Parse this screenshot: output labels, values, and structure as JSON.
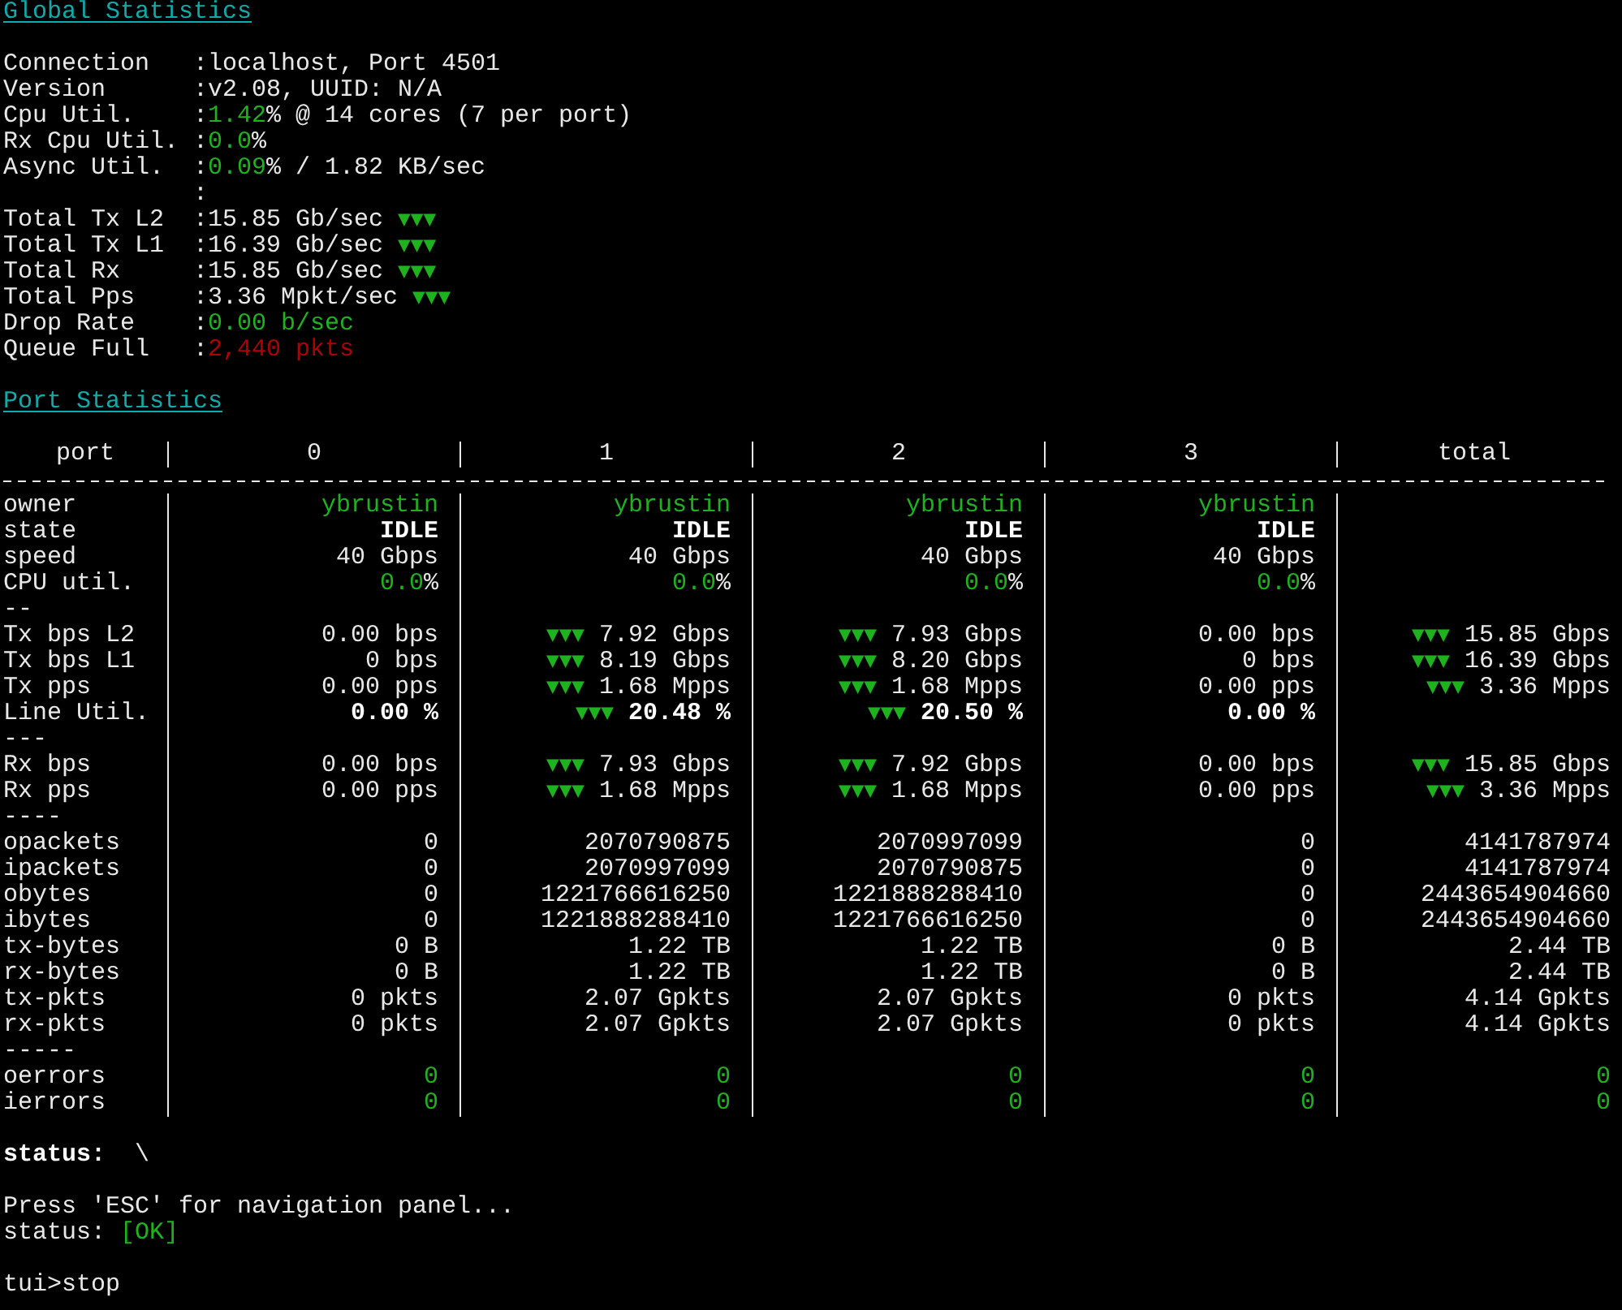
{
  "global_statistics": {
    "title": "Global Statistics",
    "lines": [
      {
        "label": "Connection",
        "sep": ":",
        "value": [
          {
            "text": "localhost, Port 4501",
            "kind": "plain"
          }
        ]
      },
      {
        "label": "Version",
        "sep": ":",
        "value": [
          {
            "text": "v2.08, UUID: N/A",
            "kind": "plain"
          }
        ]
      },
      {
        "label": "Cpu Util.",
        "sep": ":",
        "value": [
          {
            "text": "1.42",
            "kind": "green"
          },
          {
            "text": "% @ 14 cores (7 per port)",
            "kind": "plain"
          }
        ]
      },
      {
        "label": "Rx Cpu Util.",
        "sep": ":",
        "value": [
          {
            "text": "0.0",
            "kind": "green"
          },
          {
            "text": "%",
            "kind": "plain"
          }
        ]
      },
      {
        "label": "Async Util.",
        "sep": ":",
        "value": [
          {
            "text": "0.09",
            "kind": "green"
          },
          {
            "text": "% / 1.82 KB/sec",
            "kind": "plain"
          }
        ]
      },
      {
        "sep": ":"
      },
      {
        "label": "Total Tx L2",
        "sep": ":",
        "value": [
          {
            "text": "15.85 Gb/sec ",
            "kind": "plain"
          },
          {
            "text": "▼▼▼",
            "kind": "trend"
          }
        ]
      },
      {
        "label": "Total Tx L1",
        "sep": ":",
        "value": [
          {
            "text": "16.39 Gb/sec ",
            "kind": "plain"
          },
          {
            "text": "▼▼▼",
            "kind": "trend"
          }
        ]
      },
      {
        "label": "Total Rx",
        "sep": ":",
        "value": [
          {
            "text": "15.85 Gb/sec ",
            "kind": "plain"
          },
          {
            "text": "▼▼▼",
            "kind": "trend"
          }
        ]
      },
      {
        "label": "Total Pps",
        "sep": ":",
        "value": [
          {
            "text": "3.36 Mpkt/sec ",
            "kind": "plain"
          },
          {
            "text": "▼▼▼",
            "kind": "trend"
          }
        ]
      },
      {
        "label": "Drop Rate",
        "sep": ":",
        "value": [
          {
            "text": "0.00 b/sec",
            "kind": "green"
          }
        ]
      },
      {
        "label": "Queue Full",
        "sep": ":",
        "value": [
          {
            "text": "2,440 pkts",
            "kind": "red"
          }
        ]
      }
    ]
  },
  "port_statistics": {
    "title": "Port Statistics",
    "columns": [
      "port",
      "0",
      "1",
      "2",
      "3",
      "total"
    ],
    "rows": [
      {
        "label": "owner",
        "cells": [
          [
            {
              "text": "ybrustin",
              "kind": "green"
            }
          ],
          [
            {
              "text": "ybrustin",
              "kind": "green"
            }
          ],
          [
            {
              "text": "ybrustin",
              "kind": "green"
            }
          ],
          [
            {
              "text": "ybrustin",
              "kind": "green"
            }
          ]
        ]
      },
      {
        "label": "state",
        "cells": [
          [
            {
              "text": "IDLE",
              "kind": "bold"
            }
          ],
          [
            {
              "text": "IDLE",
              "kind": "bold"
            }
          ],
          [
            {
              "text": "IDLE",
              "kind": "bold"
            }
          ],
          [
            {
              "text": "IDLE",
              "kind": "bold"
            }
          ]
        ]
      },
      {
        "label": "speed",
        "cells": [
          [
            {
              "text": "40 Gbps",
              "kind": "plain"
            }
          ],
          [
            {
              "text": "40 Gbps",
              "kind": "plain"
            }
          ],
          [
            {
              "text": "40 Gbps",
              "kind": "plain"
            }
          ],
          [
            {
              "text": "40 Gbps",
              "kind": "plain"
            }
          ]
        ]
      },
      {
        "label": "CPU util.",
        "cells": [
          [
            {
              "text": "0.0",
              "kind": "green"
            },
            {
              "text": "%",
              "kind": "plain"
            }
          ],
          [
            {
              "text": "0.0",
              "kind": "green"
            },
            {
              "text": "%",
              "kind": "plain"
            }
          ],
          [
            {
              "text": "0.0",
              "kind": "green"
            },
            {
              "text": "%",
              "kind": "plain"
            }
          ],
          [
            {
              "text": "0.0",
              "kind": "green"
            },
            {
              "text": "%",
              "kind": "plain"
            }
          ]
        ]
      },
      {
        "label": "--"
      },
      {
        "label": "Tx bps L2",
        "cells": [
          [
            {
              "text": "0.00 bps",
              "kind": "plain"
            }
          ],
          [
            {
              "text": "▼▼▼",
              "kind": "trend"
            },
            {
              "text": " 7.92 Gbps",
              "kind": "plain"
            }
          ],
          [
            {
              "text": "▼▼▼",
              "kind": "trend"
            },
            {
              "text": " 7.93 Gbps",
              "kind": "plain"
            }
          ],
          [
            {
              "text": "0.00 bps",
              "kind": "plain"
            }
          ],
          [
            {
              "text": "▼▼▼",
              "kind": "trend"
            },
            {
              "text": " 15.85 Gbps",
              "kind": "plain"
            }
          ]
        ]
      },
      {
        "label": "Tx bps L1",
        "cells": [
          [
            {
              "text": "0 bps",
              "kind": "plain"
            }
          ],
          [
            {
              "text": "▼▼▼",
              "kind": "trend"
            },
            {
              "text": " 8.19 Gbps",
              "kind": "plain"
            }
          ],
          [
            {
              "text": "▼▼▼",
              "kind": "trend"
            },
            {
              "text": " 8.20 Gbps",
              "kind": "plain"
            }
          ],
          [
            {
              "text": "0 bps",
              "kind": "plain"
            }
          ],
          [
            {
              "text": "▼▼▼",
              "kind": "trend"
            },
            {
              "text": " 16.39 Gbps",
              "kind": "plain"
            }
          ]
        ]
      },
      {
        "label": "Tx pps",
        "cells": [
          [
            {
              "text": "0.00 pps",
              "kind": "plain"
            }
          ],
          [
            {
              "text": "▼▼▼",
              "kind": "trend"
            },
            {
              "text": " 1.68 Mpps",
              "kind": "plain"
            }
          ],
          [
            {
              "text": "▼▼▼",
              "kind": "trend"
            },
            {
              "text": " 1.68 Mpps",
              "kind": "plain"
            }
          ],
          [
            {
              "text": "0.00 pps",
              "kind": "plain"
            }
          ],
          [
            {
              "text": "▼▼▼",
              "kind": "trend"
            },
            {
              "text": " 3.36 Mpps",
              "kind": "plain"
            }
          ]
        ]
      },
      {
        "label": "Line Util.",
        "cells": [
          [
            {
              "text": "0.00 %",
              "kind": "bold"
            }
          ],
          [
            {
              "text": "▼▼▼",
              "kind": "trend"
            },
            {
              "text": " 20.48 %",
              "kind": "bold"
            }
          ],
          [
            {
              "text": "▼▼▼",
              "kind": "trend"
            },
            {
              "text": " 20.50 %",
              "kind": "bold"
            }
          ],
          [
            {
              "text": "0.00 %",
              "kind": "bold"
            }
          ]
        ]
      },
      {
        "label": "---"
      },
      {
        "label": "Rx bps",
        "cells": [
          [
            {
              "text": "0.00 bps",
              "kind": "plain"
            }
          ],
          [
            {
              "text": "▼▼▼",
              "kind": "trend"
            },
            {
              "text": " 7.93 Gbps",
              "kind": "plain"
            }
          ],
          [
            {
              "text": "▼▼▼",
              "kind": "trend"
            },
            {
              "text": " 7.92 Gbps",
              "kind": "plain"
            }
          ],
          [
            {
              "text": "0.00 bps",
              "kind": "plain"
            }
          ],
          [
            {
              "text": "▼▼▼",
              "kind": "trend"
            },
            {
              "text": " 15.85 Gbps",
              "kind": "plain"
            }
          ]
        ]
      },
      {
        "label": "Rx pps",
        "cells": [
          [
            {
              "text": "0.00 pps",
              "kind": "plain"
            }
          ],
          [
            {
              "text": "▼▼▼",
              "kind": "trend"
            },
            {
              "text": " 1.68 Mpps",
              "kind": "plain"
            }
          ],
          [
            {
              "text": "▼▼▼",
              "kind": "trend"
            },
            {
              "text": " 1.68 Mpps",
              "kind": "plain"
            }
          ],
          [
            {
              "text": "0.00 pps",
              "kind": "plain"
            }
          ],
          [
            {
              "text": "▼▼▼",
              "kind": "trend"
            },
            {
              "text": " 3.36 Mpps",
              "kind": "plain"
            }
          ]
        ]
      },
      {
        "label": "----"
      },
      {
        "label": "opackets",
        "cells": [
          [
            {
              "text": "0",
              "kind": "plain"
            }
          ],
          [
            {
              "text": "2070790875",
              "kind": "plain"
            }
          ],
          [
            {
              "text": "2070997099",
              "kind": "plain"
            }
          ],
          [
            {
              "text": "0",
              "kind": "plain"
            }
          ],
          [
            {
              "text": "4141787974",
              "kind": "plain"
            }
          ]
        ]
      },
      {
        "label": "ipackets",
        "cells": [
          [
            {
              "text": "0",
              "kind": "plain"
            }
          ],
          [
            {
              "text": "2070997099",
              "kind": "plain"
            }
          ],
          [
            {
              "text": "2070790875",
              "kind": "plain"
            }
          ],
          [
            {
              "text": "0",
              "kind": "plain"
            }
          ],
          [
            {
              "text": "4141787974",
              "kind": "plain"
            }
          ]
        ]
      },
      {
        "label": "obytes",
        "cells": [
          [
            {
              "text": "0",
              "kind": "plain"
            }
          ],
          [
            {
              "text": "1221766616250",
              "kind": "plain"
            }
          ],
          [
            {
              "text": "1221888288410",
              "kind": "plain"
            }
          ],
          [
            {
              "text": "0",
              "kind": "plain"
            }
          ],
          [
            {
              "text": "2443654904660",
              "kind": "plain"
            }
          ]
        ]
      },
      {
        "label": "ibytes",
        "cells": [
          [
            {
              "text": "0",
              "kind": "plain"
            }
          ],
          [
            {
              "text": "1221888288410",
              "kind": "plain"
            }
          ],
          [
            {
              "text": "1221766616250",
              "kind": "plain"
            }
          ],
          [
            {
              "text": "0",
              "kind": "plain"
            }
          ],
          [
            {
              "text": "2443654904660",
              "kind": "plain"
            }
          ]
        ]
      },
      {
        "label": "tx-bytes",
        "cells": [
          [
            {
              "text": "0 B",
              "kind": "plain"
            }
          ],
          [
            {
              "text": "1.22 TB",
              "kind": "plain"
            }
          ],
          [
            {
              "text": "1.22 TB",
              "kind": "plain"
            }
          ],
          [
            {
              "text": "0 B",
              "kind": "plain"
            }
          ],
          [
            {
              "text": "2.44 TB",
              "kind": "plain"
            }
          ]
        ]
      },
      {
        "label": "rx-bytes",
        "cells": [
          [
            {
              "text": "0 B",
              "kind": "plain"
            }
          ],
          [
            {
              "text": "1.22 TB",
              "kind": "plain"
            }
          ],
          [
            {
              "text": "1.22 TB",
              "kind": "plain"
            }
          ],
          [
            {
              "text": "0 B",
              "kind": "plain"
            }
          ],
          [
            {
              "text": "2.44 TB",
              "kind": "plain"
            }
          ]
        ]
      },
      {
        "label": "tx-pkts",
        "cells": [
          [
            {
              "text": "0 pkts",
              "kind": "plain"
            }
          ],
          [
            {
              "text": "2.07 Gpkts",
              "kind": "plain"
            }
          ],
          [
            {
              "text": "2.07 Gpkts",
              "kind": "plain"
            }
          ],
          [
            {
              "text": "0 pkts",
              "kind": "plain"
            }
          ],
          [
            {
              "text": "4.14 Gpkts",
              "kind": "plain"
            }
          ]
        ]
      },
      {
        "label": "rx-pkts",
        "cells": [
          [
            {
              "text": "0 pkts",
              "kind": "plain"
            }
          ],
          [
            {
              "text": "2.07 Gpkts",
              "kind": "plain"
            }
          ],
          [
            {
              "text": "2.07 Gpkts",
              "kind": "plain"
            }
          ],
          [
            {
              "text": "0 pkts",
              "kind": "plain"
            }
          ],
          [
            {
              "text": "4.14 Gpkts",
              "kind": "plain"
            }
          ]
        ]
      },
      {
        "label": "-----"
      },
      {
        "label": "oerrors",
        "cells": [
          [
            {
              "text": "0",
              "kind": "green"
            }
          ],
          [
            {
              "text": "0",
              "kind": "green"
            }
          ],
          [
            {
              "text": "0",
              "kind": "green"
            }
          ],
          [
            {
              "text": "0",
              "kind": "green"
            }
          ],
          [
            {
              "text": "0",
              "kind": "green"
            }
          ]
        ]
      },
      {
        "label": "ierrors",
        "cells": [
          [
            {
              "text": "0",
              "kind": "green"
            }
          ],
          [
            {
              "text": "0",
              "kind": "green"
            }
          ],
          [
            {
              "text": "0",
              "kind": "green"
            }
          ],
          [
            {
              "text": "0",
              "kind": "green"
            }
          ],
          [
            {
              "text": "0",
              "kind": "green"
            }
          ]
        ]
      }
    ]
  },
  "console": [
    {
      "kind": "blank"
    },
    {
      "kind": "line",
      "segments": [
        {
          "text": "status:",
          "kind": "bold"
        },
        {
          "text": "  \\",
          "kind": "plain"
        }
      ]
    },
    {
      "kind": "blank"
    },
    {
      "kind": "line",
      "segments": [
        {
          "text": "Press 'ESC' for navigation panel...",
          "kind": "plain"
        }
      ]
    },
    {
      "kind": "line",
      "segments": [
        {
          "text": "status: ",
          "kind": "plain"
        },
        {
          "text": "[OK]",
          "kind": "green"
        }
      ]
    },
    {
      "kind": "blank"
    },
    {
      "kind": "line",
      "segments": [
        {
          "text": "tui>stop",
          "kind": "plain"
        }
      ]
    }
  ]
}
